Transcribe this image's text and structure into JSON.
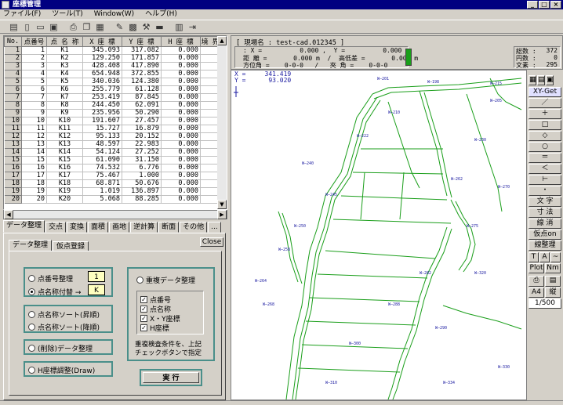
{
  "window": {
    "title": "座標管理"
  },
  "menu": [
    "ファイル(F)",
    "ツール(T)",
    "Window(W)",
    "ヘルプ(H)"
  ],
  "toolbar_icons": [
    "open-icon",
    "new-icon",
    "folder-icon",
    "save-icon",
    "print-icon",
    "copy-icon",
    "paste-icon",
    "edit-icon",
    "calc-icon",
    "tools-icon",
    "monitor-icon",
    "lock-icon",
    "exit-icon"
  ],
  "grid": {
    "headers": [
      "No.",
      "点番号",
      "点 名 称",
      "X 座 標",
      "Y 座 標",
      "H 座 標",
      "境 界"
    ],
    "rows": [
      [
        "1",
        "1",
        "K1",
        "345.093",
        "317.082",
        "0.000"
      ],
      [
        "2",
        "2",
        "K2",
        "129.250",
        "171.857",
        "0.000"
      ],
      [
        "3",
        "3",
        "K3",
        "428.408",
        "417.890",
        "0.000"
      ],
      [
        "4",
        "4",
        "K4",
        "654.948",
        "372.855",
        "0.000"
      ],
      [
        "5",
        "5",
        "K5",
        "340.036",
        "124.380",
        "0.000"
      ],
      [
        "6",
        "6",
        "K6",
        "255.779",
        "61.128",
        "0.000"
      ],
      [
        "7",
        "7",
        "K7",
        "253.419",
        "87.845",
        "0.000"
      ],
      [
        "8",
        "8",
        "K8",
        "244.450",
        "62.091",
        "0.000"
      ],
      [
        "9",
        "9",
        "K9",
        "235.956",
        "50.290",
        "0.000"
      ],
      [
        "10",
        "10",
        "K10",
        "191.607",
        "27.457",
        "0.000"
      ],
      [
        "11",
        "11",
        "K11",
        "15.727",
        "16.879",
        "0.000"
      ],
      [
        "12",
        "12",
        "K12",
        "95.133",
        "20.152",
        "0.000"
      ],
      [
        "13",
        "13",
        "K13",
        "48.597",
        "22.983",
        "0.000"
      ],
      [
        "14",
        "14",
        "K14",
        "54.124",
        "27.252",
        "0.000"
      ],
      [
        "15",
        "15",
        "K15",
        "61.090",
        "31.150",
        "0.000"
      ],
      [
        "16",
        "16",
        "K16",
        "74.532",
        "6.776",
        "0.000"
      ],
      [
        "17",
        "17",
        "K17",
        "75.467",
        "1.000",
        "0.000"
      ],
      [
        "18",
        "18",
        "K18",
        "68.871",
        "50.676",
        "0.000"
      ],
      [
        "19",
        "19",
        "K19",
        "1.019",
        "136.897",
        "0.000"
      ],
      [
        "20",
        "20",
        "K20",
        "5.068",
        "88.285",
        "0.000"
      ]
    ]
  },
  "tabs": [
    "データ整理",
    "交点",
    "変換",
    "面積",
    "画地",
    "逆計算",
    "断面",
    "その他",
    "..."
  ],
  "subtabs": [
    "データ整理",
    "仮点登録"
  ],
  "close_label": "Close",
  "left_options": {
    "renumber": "点番号整理",
    "rename": "点名称付替 →",
    "box1": "1",
    "box2": "K",
    "sort_asc": "点名称ソート(昇順)",
    "sort_desc": "点名称ソート(降順)",
    "delete": "(削除)データ整理",
    "h_adjust": "H座標調整(Draw)"
  },
  "right_options": {
    "dup": "重複データ整理",
    "checks": [
      "点番号",
      "点名称",
      "X・Y座標",
      "H座標"
    ],
    "note1": "重複検査条件を、上記",
    "note2": "チェックボタンで指定"
  },
  "run_label": "実 行",
  "info": {
    "site": "[ 現場名 : test-cad.012345 ]",
    "line1": ": X =          0.000 ,  Y =          0.000",
    "line2": "距 離 =       0.000 m  /  高低差 =       0.000 m",
    "line3": "方位角 =    0-0-0   /   夾 角 =    0-0-0",
    "count1_label": "総数 :",
    "count1": "372",
    "count2_label": "円数 :",
    "count2": "0",
    "count3_label": "文素 :",
    "count3": "295"
  },
  "coord": {
    "x": "X =     341.419",
    "y": "Y =      93.020"
  },
  "palette": [
    "XY-Get",
    "／",
    "＋",
    "□",
    "◇",
    "○",
    "＝",
    "＜",
    "⊢",
    "・",
    "文 字",
    "寸 法",
    "線 消",
    "仮点on",
    "線整理",
    "T",
    "A",
    "~",
    "Plot",
    "Nm",
    "A4",
    "縦",
    "1/500"
  ],
  "colors": {
    "title": "#000080",
    "drawing_line": "#1a9e1a",
    "drawing_bg": "#ffffff",
    "label_blue": "#1a1aa0"
  }
}
